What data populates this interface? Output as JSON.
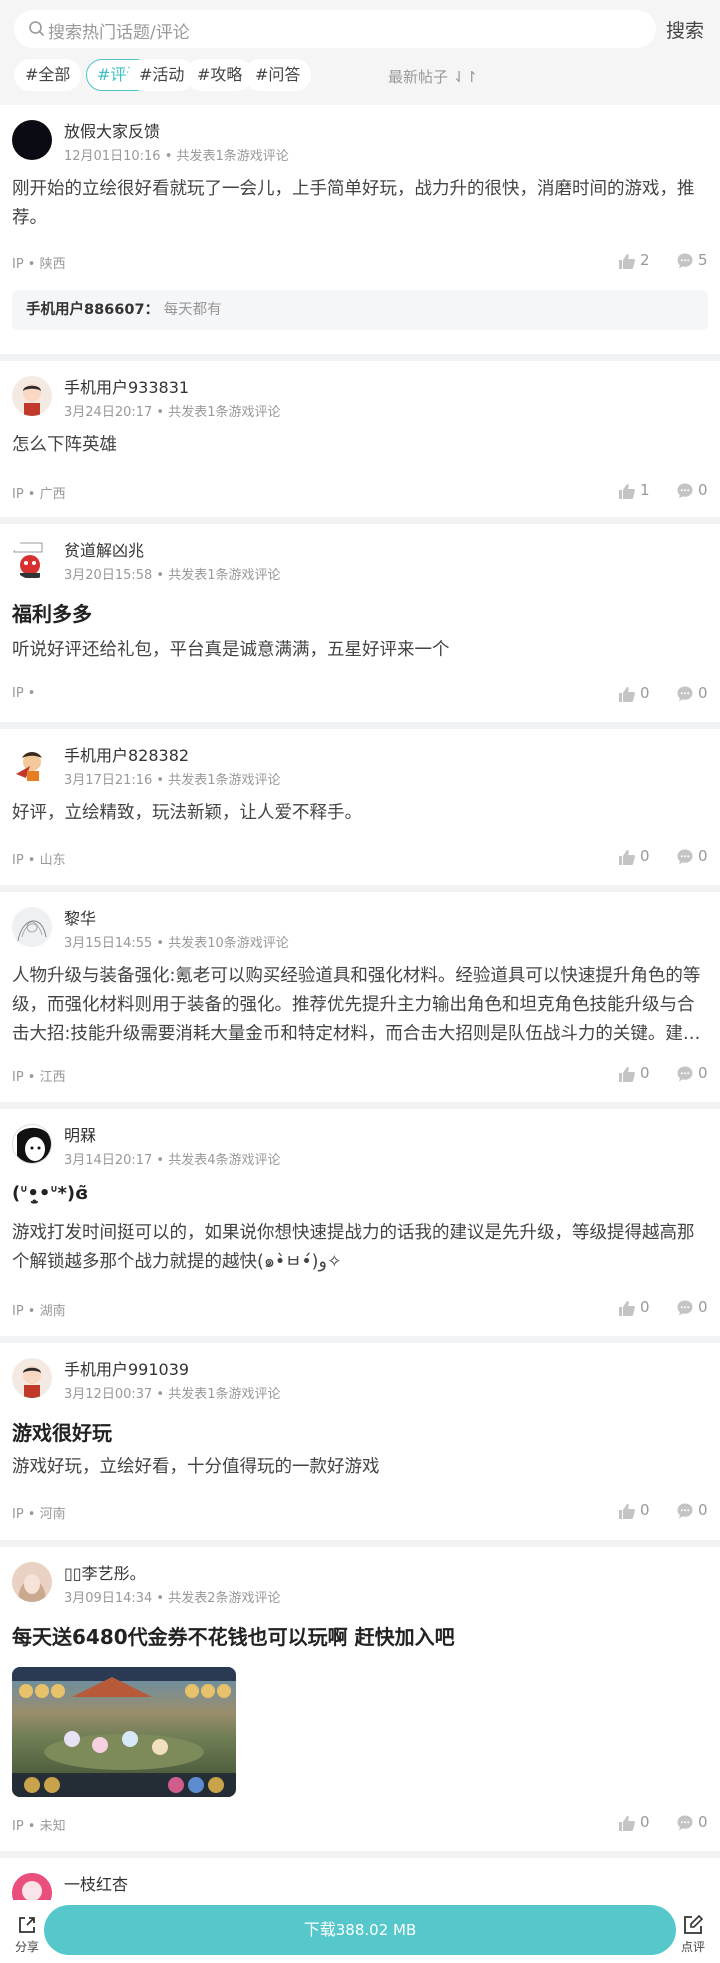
{
  "search": {
    "placeholder": "搜索热门话题/评论",
    "button": "搜索"
  },
  "tags": [
    "#全部",
    "#评论",
    "#活动",
    "#攻略",
    "#问答"
  ],
  "sort_label": "最新帖子",
  "posts": [
    {
      "user": "放假大家反馈",
      "date": "12月01日10:16",
      "count": "共发表1条游戏评论",
      "content": "刚开始的立绘很好看就玩了一会儿，上手简单好玩，战力升的很快，消磨时间的游戏，推荐。",
      "ip": "IP • 陕西",
      "likes": "2",
      "comments": "5",
      "reply_user": "手机用户886607：",
      "reply_text": "每天都有"
    },
    {
      "user": "手机用户933831",
      "date": "3月24日20:17",
      "count": "共发表1条游戏评论",
      "content": "怎么下阵英雄",
      "ip": "IP • 广西",
      "likes": "1",
      "comments": "0"
    },
    {
      "user": "贫道解凶兆",
      "date": "3月20日15:58",
      "count": "共发表1条游戏评论",
      "title": "福利多多",
      "content": "听说好评还给礼包，平台真是诚意满满，五星好评来一个",
      "ip": "IP •",
      "likes": "0",
      "comments": "0"
    },
    {
      "user": "手机用户828382",
      "date": "3月17日21:16",
      "count": "共发表1条游戏评论",
      "content": "好评，立绘精致，玩法新颖，让人爱不释手。",
      "ip": "IP • 山东",
      "likes": "0",
      "comments": "0"
    },
    {
      "user": "黎华",
      "date": "3月15日14:55",
      "count": "共发表10条游戏评论",
      "content": "人物升级与装备强化:氪老可以购买经验道具和强化材料。经验道具可以快速提升角色的等级，而强化材料则用于装备的强化。推荐优先提升主力输出角色和坦克角色技能升级与合击大招:技能升级需要消耗大量金币和特定材料，而合击大招则是队伍战斗力的关键。建…",
      "ip": "IP • 江西",
      "likes": "0",
      "comments": "0"
    },
    {
      "user": "明槑",
      "date": "3月14日20:17",
      "count": "共发表4条游戏评论",
      "title": "(ᐡ•̥̫•ᐡ*)ɞ̃",
      "content": "游戏打发时间挺可以的，如果说你想快速提战力的话我的建议是先升级，等级提得越高那个解锁越多那个战力就提的越快(๑•̀ㅂ•́)و✧",
      "ip": "IP • 湖南",
      "likes": "0",
      "comments": "0"
    },
    {
      "user": "手机用户991039",
      "date": "3月12日00:37",
      "count": "共发表1条游戏评论",
      "title": "游戏很好玩",
      "content": "游戏好玩，立绘好看，十分值得玩的一款好游戏",
      "ip": "IP • 河南",
      "likes": "0",
      "comments": "0"
    },
    {
      "user": "▯▯李艺彤。",
      "date": "3月09日14:34",
      "count": "共发表2条游戏评论",
      "title": "每天送6480代金券不花钱也可以玩啊 赶快加入吧",
      "ip": "IP • 未知",
      "likes": "0",
      "comments": "0"
    },
    {
      "user": "一枝红杏"
    }
  ],
  "bottom": {
    "share": "分享",
    "download_prefix": "下载",
    "download_size": "388.02 MB",
    "review": "点评"
  },
  "colors": {
    "accent": "#56c8cc",
    "tag_active": "#3fbfc2"
  }
}
